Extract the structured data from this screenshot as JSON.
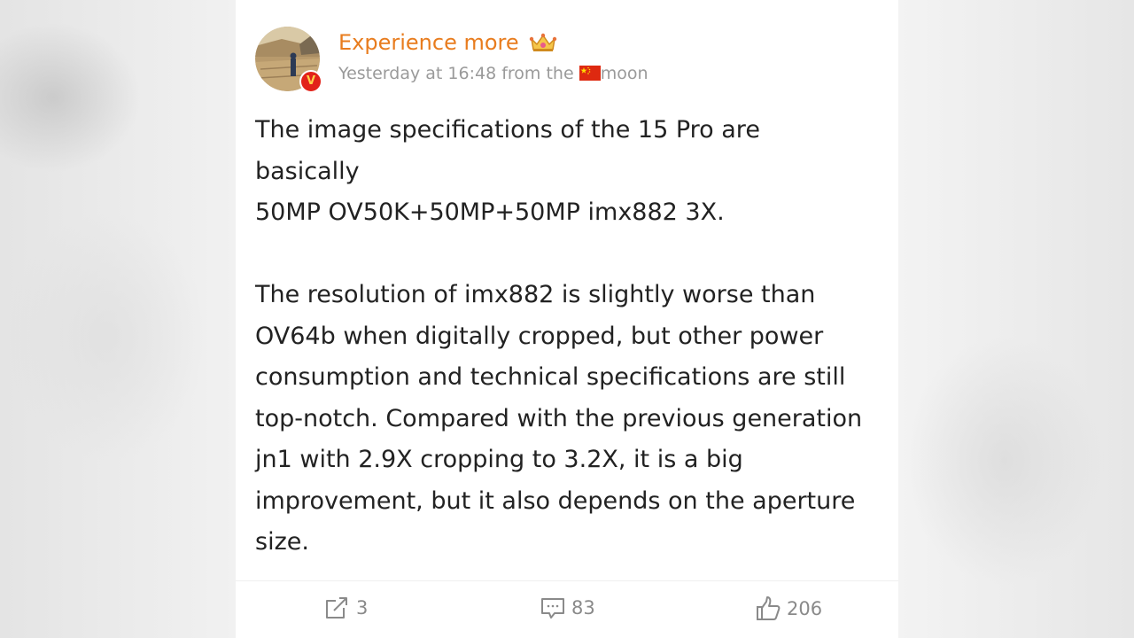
{
  "post": {
    "author": {
      "name": "Experience more",
      "verified_badge": "V",
      "crown_icon": "crown-icon"
    },
    "meta": {
      "time": "Yesterday at 16:48 from the",
      "source": "moon",
      "flag_icon": "china-flag-icon"
    },
    "paragraphs": [
      "The image specifications of the 15 Pro are\nbasically\n50MP OV50K+50MP+50MP imx882 3X.",
      "The resolution of imx882 is slightly worse than\nOV64b when digitally cropped, but other power\nconsumption and technical specifications are still\ntop-notch. Compared with the previous generation\njn1 with 2.9X cropping to 3.2X, it is a big\nimprovement, but it also depends on the aperture\nsize."
    ],
    "actions": {
      "repost_count": "3",
      "comment_count": "83",
      "like_count": "206"
    }
  },
  "colors": {
    "username": "#e87c1e",
    "meta_text": "#9a9a9a",
    "body_text": "#222222",
    "action_text": "#8a8a8a",
    "badge": "#e2231a"
  }
}
